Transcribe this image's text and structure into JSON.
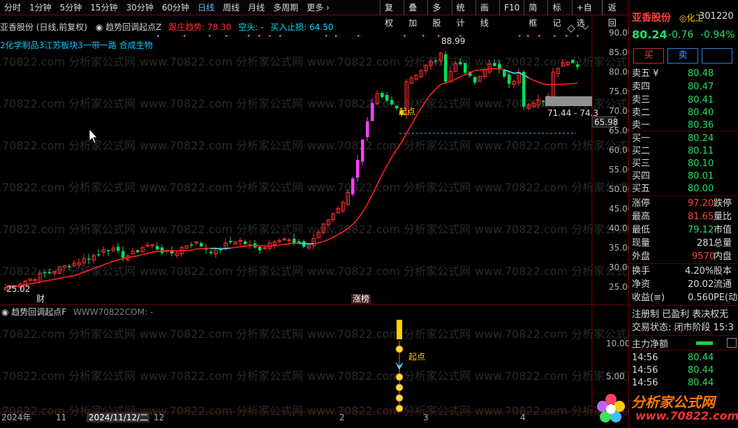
{
  "toolbar": {
    "periods": [
      "分时",
      "1分钟",
      "5分钟",
      "15分钟",
      "30分钟",
      "60分钟",
      "日线",
      "周线",
      "月线",
      "多周期",
      "更多 ›"
    ],
    "actions": [
      "复权",
      "叠加",
      "多股",
      "统计",
      "画线",
      "F10",
      "简框",
      "标记",
      "+自选"
    ],
    "back": "返回"
  },
  "chart": {
    "stock_label": "亚香股份 (日线,前复权)",
    "indicator_name": "趋势回调起点Z",
    "trend_text": "跟庄趋势: 78.30",
    "short_text": "空头: -",
    "stop_text": "买入止损: 64.50",
    "sectors": "2化学制品3江苏板块3一带一路 合成生物",
    "high_mark": "88.99",
    "low_mark": "25.02",
    "range_label": "71.44 - 74.3",
    "level_label": "65.98",
    "qidian_label": "起点",
    "zhangbang_label": "涨榜",
    "cai_label": "财",
    "price_ticks": [
      "90.00",
      "85.00",
      "80.00",
      "75.00",
      "70.00",
      "65.00",
      "60.00",
      "55.00",
      "50.00",
      "45.00",
      "40.00",
      "35.00",
      "30.00",
      "25.00"
    ],
    "sub_indicator": "趋势回调起点F",
    "sub_indicator_extra": "WWW70822COM: -",
    "sub_ticks": [
      "10.00",
      "5.00"
    ],
    "sub_qidian": "起点",
    "date_labels": [
      "2024年",
      "11",
      "2024/11/12/二",
      "12",
      "2",
      "3",
      "4"
    ],
    "watermark": "www.70822.com 分析家公式网"
  },
  "quote": {
    "name": "亚香股份",
    "sector_icon": "◎化工",
    "code": "301220",
    "price": "80.24",
    "change": "-0.76",
    "pct": "-0.94%",
    "buy_btn": "买",
    "sell_btn": "卖",
    "asks": [
      {
        "label": "卖五 ¥",
        "price": "80.48"
      },
      {
        "label": "卖四",
        "price": "80.47"
      },
      {
        "label": "卖三",
        "price": "80.41"
      },
      {
        "label": "卖二",
        "price": "80.40"
      },
      {
        "label": "卖一",
        "price": "80.36"
      }
    ],
    "bids": [
      {
        "label": "买一",
        "price": "80.24"
      },
      {
        "label": "买二",
        "price": "80.11"
      },
      {
        "label": "买三",
        "price": "80.10"
      },
      {
        "label": "买四",
        "price": "80.01"
      },
      {
        "label": "买五",
        "price": "80.00"
      }
    ],
    "stats": [
      {
        "label": "涨停",
        "value": "97.20",
        "color": "red",
        "label2": "跌停"
      },
      {
        "label": "最高",
        "value": "81.65",
        "color": "red",
        "label2": "量比"
      },
      {
        "label": "最低",
        "value": "79.12",
        "color": "green",
        "label2": "市值"
      },
      {
        "label": "现量",
        "value": "281",
        "color": "white",
        "label2": "总量"
      },
      {
        "label": "外盘",
        "value": "9570",
        "color": "red",
        "label2": "内盘"
      }
    ],
    "stats2": [
      {
        "label": "换手",
        "value": "4.20%",
        "label2": "股本"
      },
      {
        "label": "净资",
        "value": "20.02",
        "label2": "流通"
      },
      {
        "label": "收益(≡)",
        "value": "0.560",
        "label2": "PE(动"
      }
    ],
    "flags": "注册制 已盈利 表决权无",
    "trade_status": "交易状态: 闭市阶段 15:3",
    "main_flow": "主力净额",
    "ticks": [
      {
        "time": "14:56",
        "price": "80.44"
      },
      {
        "time": "14:56",
        "price": "80.44"
      },
      {
        "time": "14:56",
        "price": "80.44"
      }
    ]
  },
  "logo": {
    "name": "分析家公式网",
    "url": "www.70822.com"
  },
  "colors": {
    "up": "#ff3030",
    "down": "#00e060",
    "ma": "#ff2020",
    "ma_alt": "#40e0ff",
    "magenta": "#ff40ff",
    "yellow": "#ffd000"
  }
}
